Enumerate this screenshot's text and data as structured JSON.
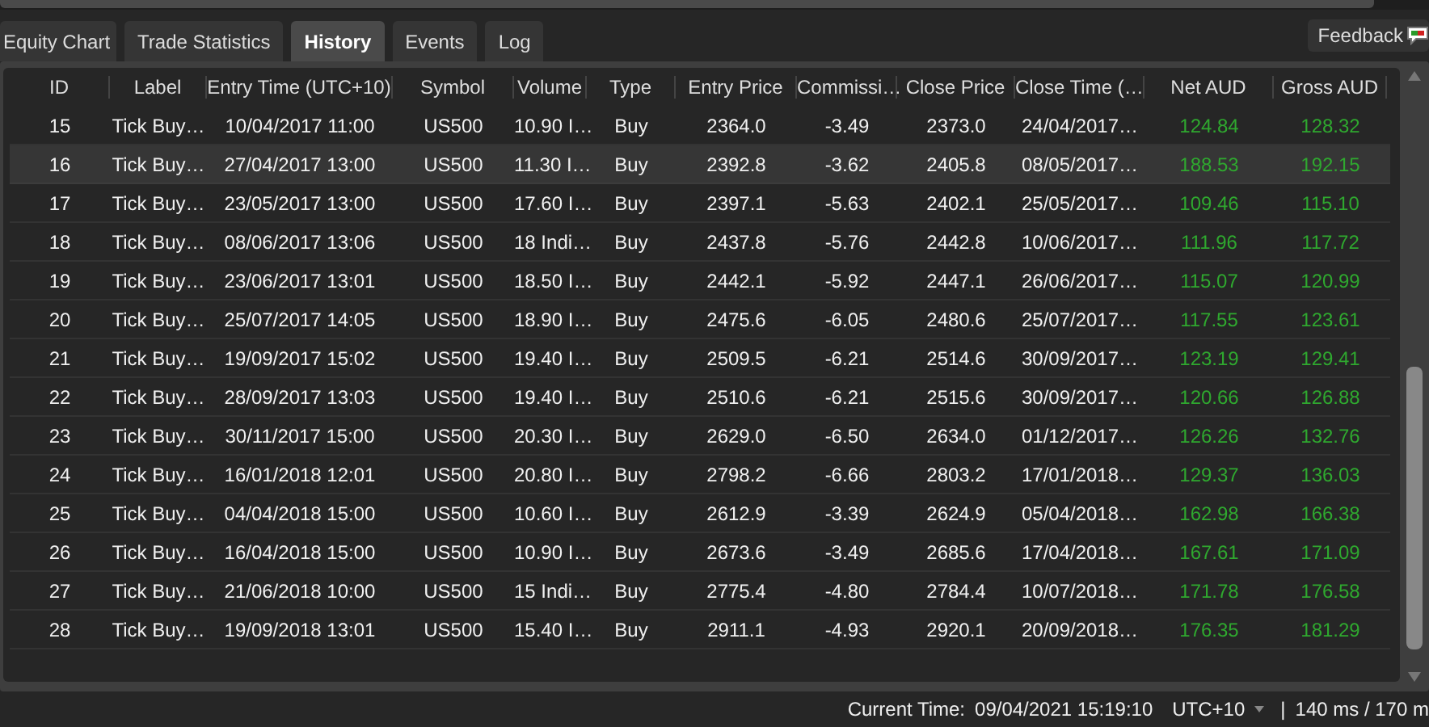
{
  "tabs": [
    {
      "label": "Equity Chart",
      "selected": false
    },
    {
      "label": "Trade Statistics",
      "selected": false
    },
    {
      "label": "History",
      "selected": true
    },
    {
      "label": "Events",
      "selected": false
    },
    {
      "label": "Log",
      "selected": false
    }
  ],
  "feedback_button": {
    "label": "Feedback"
  },
  "table": {
    "columns": [
      "ID",
      "Label",
      "Entry Time (UTC+10)",
      "Symbol",
      "Volume",
      "Type",
      "Entry Price",
      "Commissi…",
      "Close Price",
      "Close Time (…",
      "Net AUD",
      "Gross AUD"
    ],
    "rows": [
      {
        "selected": false,
        "cells": [
          "15",
          "Tick Buy…",
          "10/04/2017 11:00",
          "US500",
          "10.90 I…",
          "Buy",
          "2364.0",
          "-3.49",
          "2373.0",
          "24/04/2017…",
          "124.84",
          "128.32"
        ]
      },
      {
        "selected": true,
        "cells": [
          "16",
          "Tick Buy…",
          "27/04/2017 13:00",
          "US500",
          "11.30 I…",
          "Buy",
          "2392.8",
          "-3.62",
          "2405.8",
          "08/05/2017…",
          "188.53",
          "192.15"
        ]
      },
      {
        "selected": false,
        "cells": [
          "17",
          "Tick Buy…",
          "23/05/2017 13:00",
          "US500",
          "17.60 I…",
          "Buy",
          "2397.1",
          "-5.63",
          "2402.1",
          "25/05/2017…",
          "109.46",
          "115.10"
        ]
      },
      {
        "selected": false,
        "cells": [
          "18",
          "Tick Buy…",
          "08/06/2017 13:06",
          "US500",
          "18 Indi…",
          "Buy",
          "2437.8",
          "-5.76",
          "2442.8",
          "10/06/2017…",
          "111.96",
          "117.72"
        ]
      },
      {
        "selected": false,
        "cells": [
          "19",
          "Tick Buy…",
          "23/06/2017 13:01",
          "US500",
          "18.50 I…",
          "Buy",
          "2442.1",
          "-5.92",
          "2447.1",
          "26/06/2017…",
          "115.07",
          "120.99"
        ]
      },
      {
        "selected": false,
        "cells": [
          "20",
          "Tick Buy…",
          "25/07/2017 14:05",
          "US500",
          "18.90 I…",
          "Buy",
          "2475.6",
          "-6.05",
          "2480.6",
          "25/07/2017…",
          "117.55",
          "123.61"
        ]
      },
      {
        "selected": false,
        "cells": [
          "21",
          "Tick Buy…",
          "19/09/2017 15:02",
          "US500",
          "19.40 I…",
          "Buy",
          "2509.5",
          "-6.21",
          "2514.6",
          "30/09/2017…",
          "123.19",
          "129.41"
        ]
      },
      {
        "selected": false,
        "cells": [
          "22",
          "Tick Buy…",
          "28/09/2017 13:03",
          "US500",
          "19.40 I…",
          "Buy",
          "2510.6",
          "-6.21",
          "2515.6",
          "30/09/2017…",
          "120.66",
          "126.88"
        ]
      },
      {
        "selected": false,
        "cells": [
          "23",
          "Tick Buy…",
          "30/11/2017 15:00",
          "US500",
          "20.30 I…",
          "Buy",
          "2629.0",
          "-6.50",
          "2634.0",
          "01/12/2017…",
          "126.26",
          "132.76"
        ]
      },
      {
        "selected": false,
        "cells": [
          "24",
          "Tick Buy…",
          "16/01/2018 12:01",
          "US500",
          "20.80 I…",
          "Buy",
          "2798.2",
          "-6.66",
          "2803.2",
          "17/01/2018…",
          "129.37",
          "136.03"
        ]
      },
      {
        "selected": false,
        "cells": [
          "25",
          "Tick Buy…",
          "04/04/2018 15:00",
          "US500",
          "10.60 I…",
          "Buy",
          "2612.9",
          "-3.39",
          "2624.9",
          "05/04/2018…",
          "162.98",
          "166.38"
        ]
      },
      {
        "selected": false,
        "cells": [
          "26",
          "Tick Buy…",
          "16/04/2018 15:00",
          "US500",
          "10.90 I…",
          "Buy",
          "2673.6",
          "-3.49",
          "2685.6",
          "17/04/2018…",
          "167.61",
          "171.09"
        ]
      },
      {
        "selected": false,
        "cells": [
          "27",
          "Tick Buy…",
          "21/06/2018 10:00",
          "US500",
          "15 Indi…",
          "Buy",
          "2775.4",
          "-4.80",
          "2784.4",
          "10/07/2018…",
          "171.78",
          "176.58"
        ]
      },
      {
        "selected": false,
        "cells": [
          "28",
          "Tick Buy…",
          "19/09/2018 13:01",
          "US500",
          "15.40 I…",
          "Buy",
          "2911.1",
          "-4.93",
          "2920.1",
          "20/09/2018…",
          "176.35",
          "181.29"
        ]
      }
    ]
  },
  "status_bar": {
    "current_time_label": "Current Time:",
    "current_time": "09/04/2021 15:19:10",
    "timezone": "UTC+10",
    "separator": "|",
    "latency": "140 ms / 170 m"
  }
}
